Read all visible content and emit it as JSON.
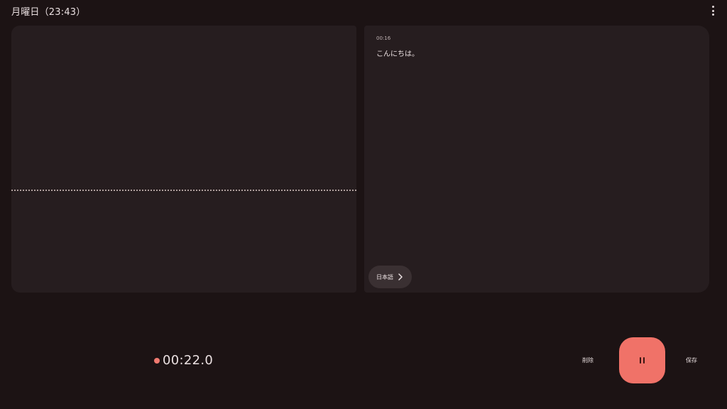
{
  "header": {
    "title": "月曜日（23:43）",
    "menu_icon": "more-vert-icon"
  },
  "waveform": {
    "icon": "waveform-baseline"
  },
  "transcript": {
    "timestamp": "00:16",
    "text": "こんにちは。",
    "language_chip": {
      "label": "日本語",
      "icon": "chevron-right-icon"
    }
  },
  "controls": {
    "elapsed": "00:22.0",
    "delete_label": "削除",
    "save_label": "保存",
    "pause_icon": "pause-icon"
  },
  "colors": {
    "background": "#1c1314",
    "panel": "#261d1f",
    "chip": "#3a3032",
    "accent": "#f07268",
    "text": "#e8dedf"
  }
}
